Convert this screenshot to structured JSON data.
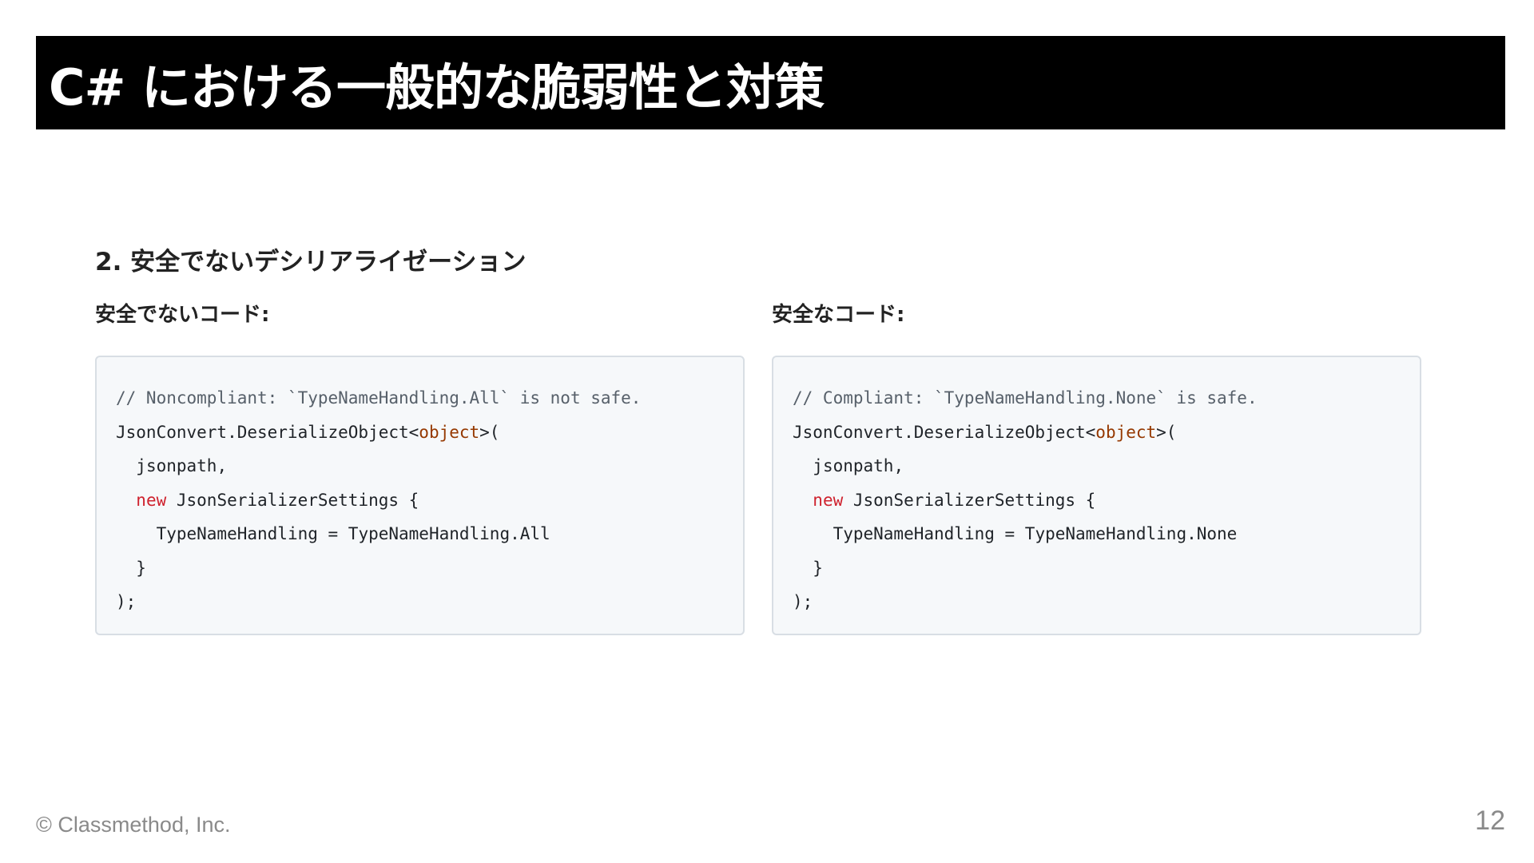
{
  "slide": {
    "title": "C# における一般的な脆弱性と対策",
    "section_heading": "2. 安全でないデシリアライゼーション",
    "footer": "© Classmethod, Inc.",
    "page_number": "12"
  },
  "columns": {
    "insecure": {
      "label": "安全でないコード:",
      "lines": [
        {
          "comment": "// Noncompliant: `TypeNameHandling.All` is not safe."
        },
        {
          "a": "JsonConvert.DeserializeObject<",
          "type": "object",
          "b": ">("
        },
        {
          "indent": "  ",
          "a": "jsonpath,"
        },
        {
          "indent": "  ",
          "keyword": "new",
          "a": " JsonSerializerSettings {"
        },
        {
          "indent": "    ",
          "a": "TypeNameHandling = TypeNameHandling.All"
        },
        {
          "indent": "  ",
          "a": "}"
        },
        {
          "a": ");"
        }
      ]
    },
    "secure": {
      "label": "安全なコード:",
      "lines": [
        {
          "comment": "// Compliant: `TypeNameHandling.None` is safe."
        },
        {
          "a": "JsonConvert.DeserializeObject<",
          "type": "object",
          "b": ">("
        },
        {
          "indent": "  ",
          "a": "jsonpath,"
        },
        {
          "indent": "  ",
          "keyword": "new",
          "a": " JsonSerializerSettings {"
        },
        {
          "indent": "    ",
          "a": "TypeNameHandling = TypeNameHandling.None"
        },
        {
          "indent": "  ",
          "a": "}"
        },
        {
          "a": ");"
        }
      ]
    }
  },
  "colors": {
    "title_bar": "#000000",
    "code_background": "#f6f8fa",
    "keyword": "#cf222e",
    "type": "#953800",
    "comment": "#57606a"
  }
}
